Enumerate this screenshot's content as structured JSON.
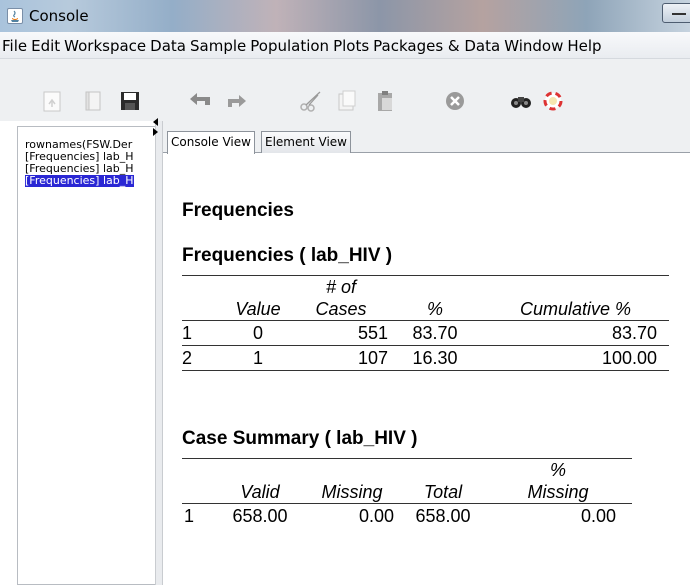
{
  "window": {
    "title": "Console"
  },
  "menu": {
    "items": [
      "File",
      "Edit",
      "Workspace",
      "Data",
      "Sample",
      "Population",
      "Plots",
      "Packages & Data",
      "Window",
      "Help"
    ]
  },
  "toolbar": {
    "icons": [
      "open-report-icon",
      "notebook-icon",
      "save-icon",
      "undo-icon",
      "redo-icon",
      "cut-icon",
      "copy-icon",
      "paste-icon",
      "stop-icon",
      "find-icon",
      "help-icon"
    ]
  },
  "history": {
    "items": [
      "rownames(FSW.Der",
      "[Frequencies] lab_H",
      "[Frequencies] lab_H",
      "[Frequencies] lab_H"
    ],
    "selected_index": 3
  },
  "tabs": [
    {
      "label": "Console View",
      "active": true
    },
    {
      "label": "Element View",
      "active": false
    }
  ],
  "output": {
    "heading": "Frequencies",
    "frequencies_table": {
      "title": "Frequencies ( lab_HIV )",
      "headers": {
        "value": "Value",
        "cases_top": "# of",
        "cases_bottom": "Cases",
        "percent": "%",
        "cumulative": "Cumulative %"
      },
      "rows": [
        {
          "n": "1",
          "value": "0",
          "cases": "551",
          "percent": "83.70",
          "cumulative": "83.70"
        },
        {
          "n": "2",
          "value": "1",
          "cases": "107",
          "percent": "16.30",
          "cumulative": "100.00"
        }
      ]
    },
    "case_summary_table": {
      "title": "Case Summary ( lab_HIV )",
      "headers": {
        "valid": "Valid",
        "missing": "Missing",
        "total": "Total",
        "pct_missing_top": "%",
        "pct_missing_bottom": "Missing"
      },
      "rows": [
        {
          "n": "1",
          "valid": "658.00",
          "missing": "0.00",
          "total": "658.00",
          "pct_missing": "0.00"
        }
      ]
    }
  },
  "colors": {
    "selection": "#2a27d4",
    "toolbar_bg": "#eef0f2"
  }
}
